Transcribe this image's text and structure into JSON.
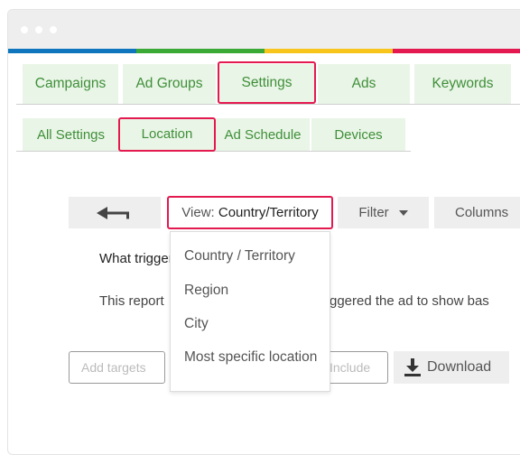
{
  "window": {
    "stripe_colors": [
      "#0f75bd",
      "#3aa935",
      "#f7c51c",
      "#e3194f"
    ]
  },
  "main_tabs": [
    {
      "label": "Campaigns"
    },
    {
      "label": "Ad Groups"
    },
    {
      "label": "Settings"
    },
    {
      "label": "Ads"
    },
    {
      "label": "Keywords"
    }
  ],
  "sub_tabs": [
    {
      "label": "All Settings"
    },
    {
      "label": "Location"
    },
    {
      "label": "Ad Schedule"
    },
    {
      "label": "Devices"
    }
  ],
  "toolbar": {
    "back_icon": "arrow-left-icon",
    "view_prefix": "View: ",
    "view_value": "Country/Territory",
    "filter_label": "Filter",
    "filter_icon": "caret-down-icon",
    "columns_label": "Columns"
  },
  "view_menu": {
    "options": [
      "Country / Territory",
      "Region",
      "City",
      "Most specific location"
    ]
  },
  "content": {
    "heading_visible": "What trigger",
    "desc_left": "This report",
    "desc_right": "ggered the ad to show bas"
  },
  "actions": {
    "add_targets_placeholder": "Add targets",
    "include_placeholder": "Include",
    "download_label": "Download",
    "download_icon": "download-icon"
  },
  "colors": {
    "accent": "#e3194f",
    "tab_bg": "#e9f5e6",
    "tab_text": "#3f8f3a"
  }
}
